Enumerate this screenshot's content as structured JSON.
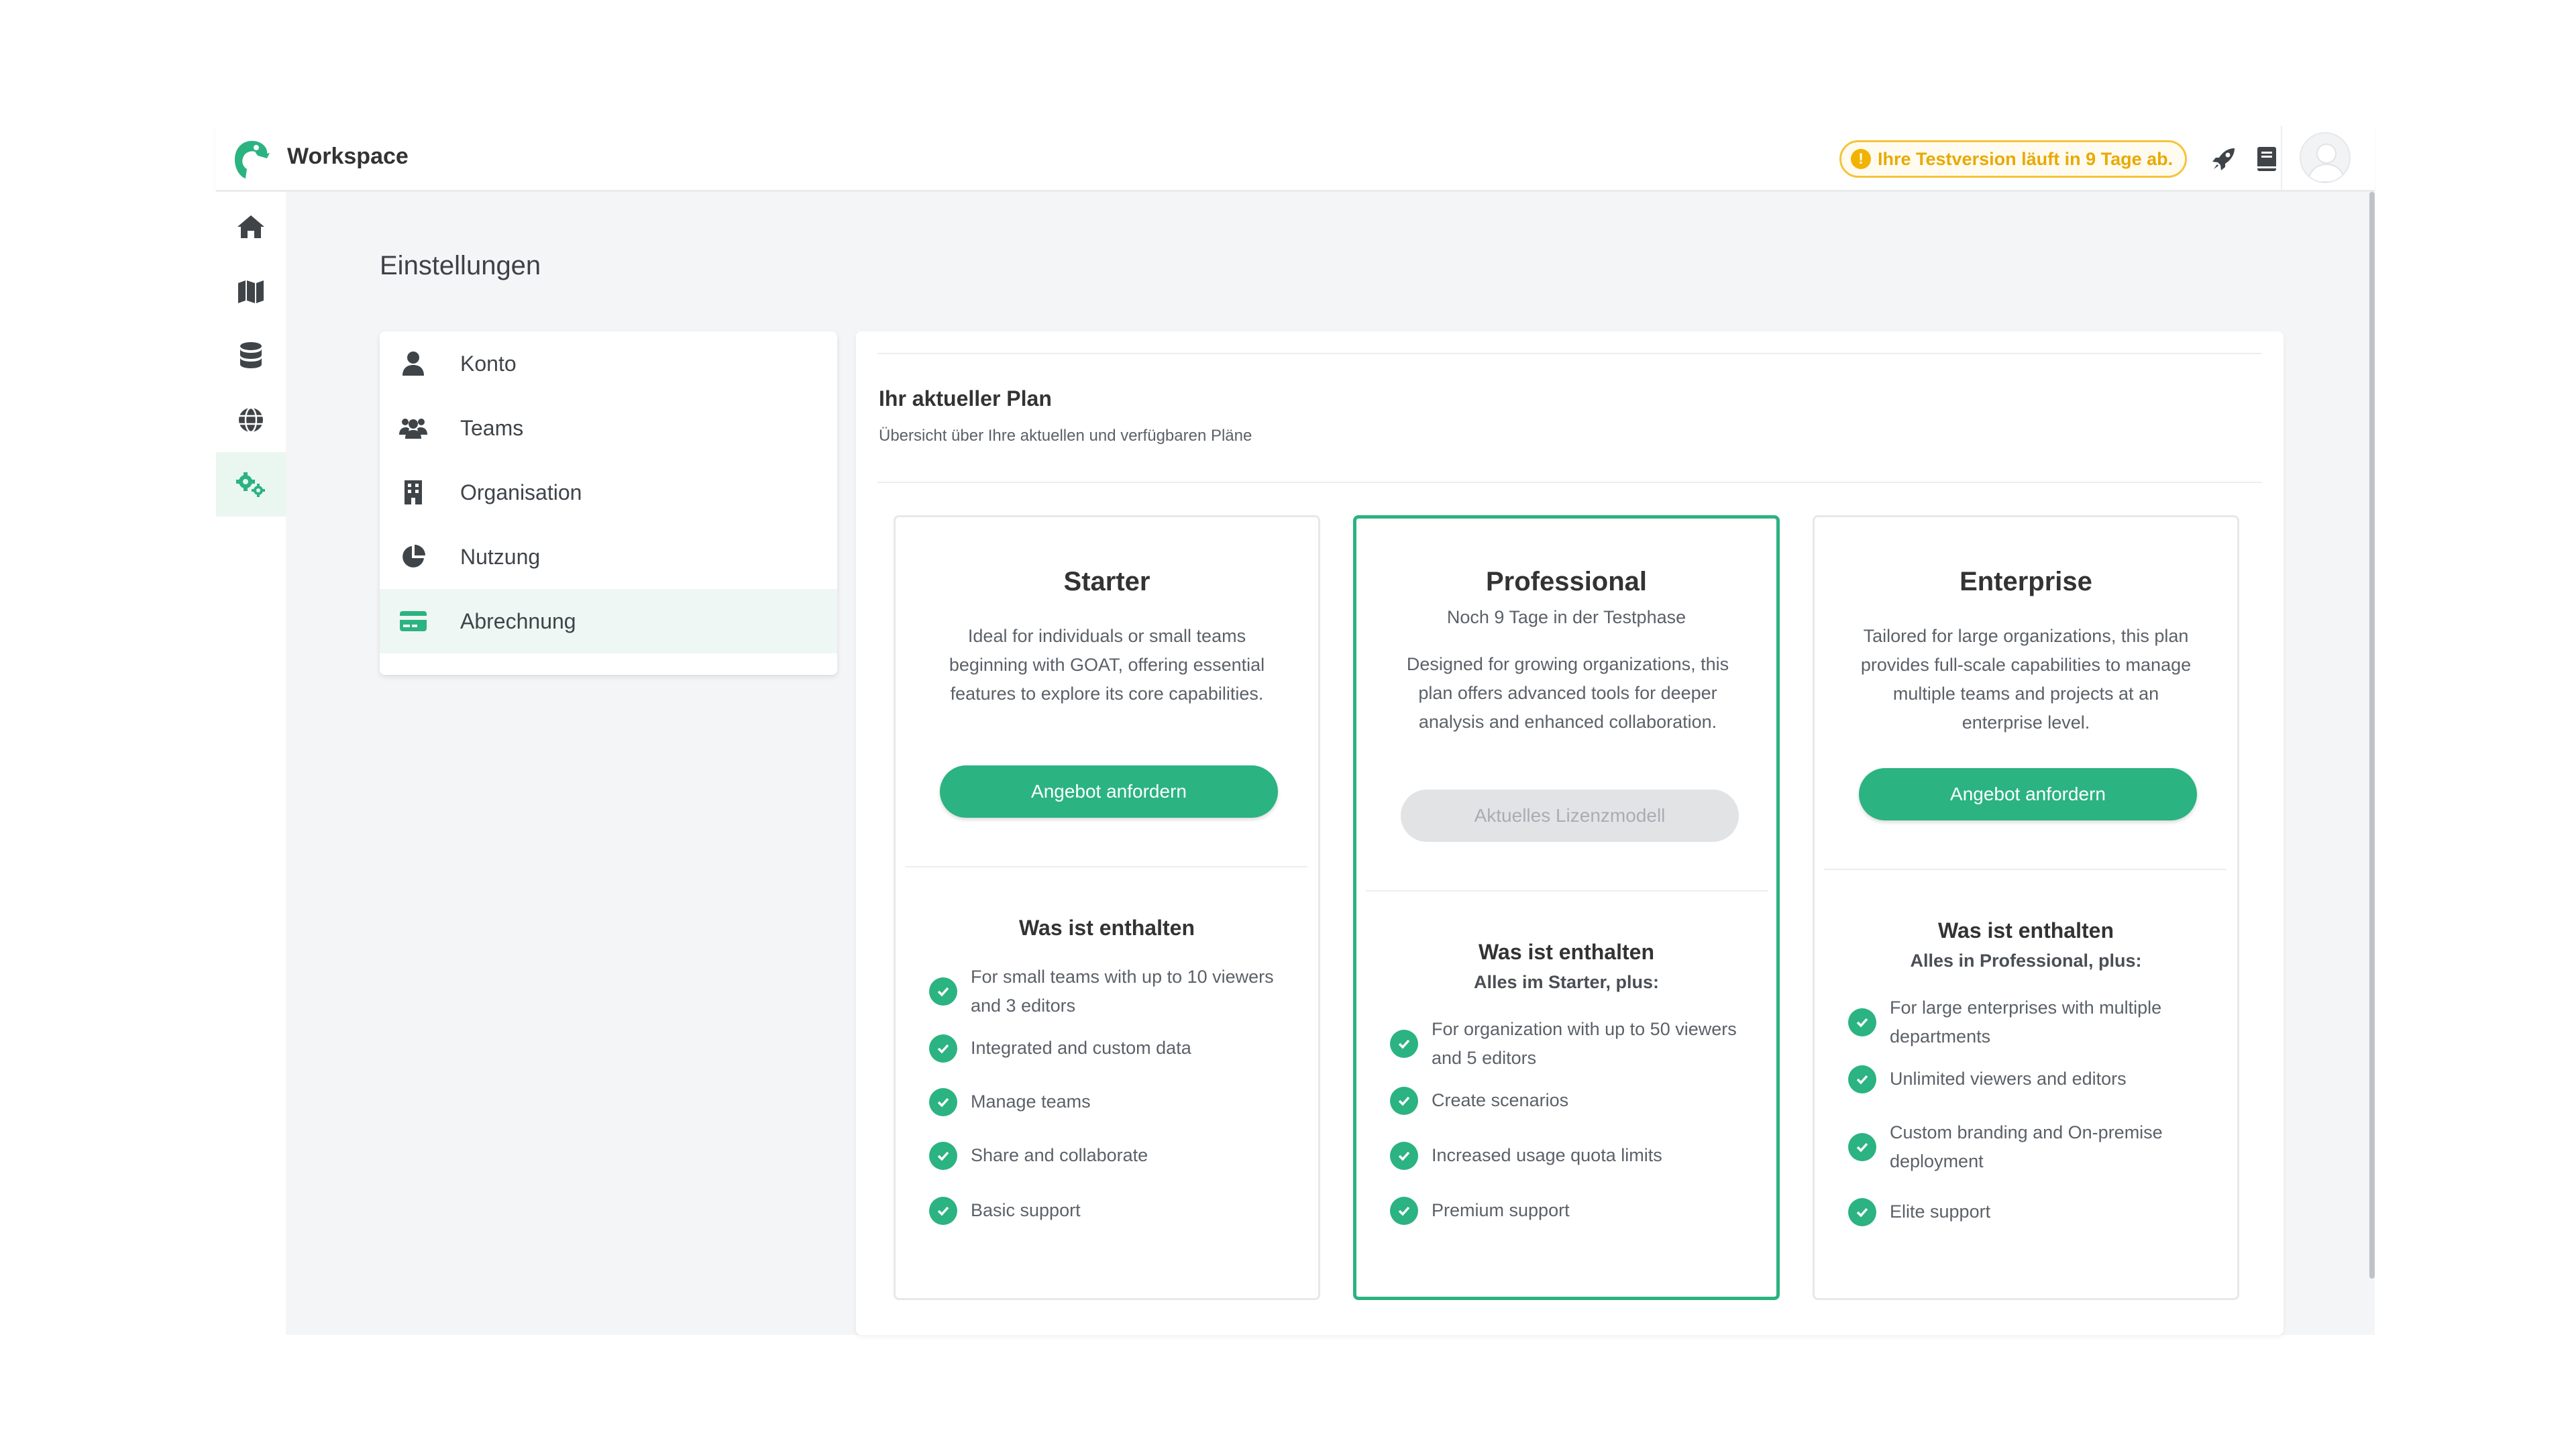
{
  "header": {
    "brand": "Workspace",
    "trial_notice": "Ihre Testversion läuft in 9 Tage ab.",
    "icons": [
      "rocket-icon",
      "book-icon"
    ]
  },
  "sidebar": {
    "items": [
      {
        "icon": "home-icon"
      },
      {
        "icon": "map-icon"
      },
      {
        "icon": "database-icon"
      },
      {
        "icon": "globe-icon"
      },
      {
        "icon": "settings-gears-icon",
        "active": true
      }
    ]
  },
  "page": {
    "title": "Einstellungen"
  },
  "settings_menu": {
    "items": [
      {
        "label": "Konto",
        "icon": "user-icon"
      },
      {
        "label": "Teams",
        "icon": "users-icon"
      },
      {
        "label": "Organisation",
        "icon": "building-icon"
      },
      {
        "label": "Nutzung",
        "icon": "pie-chart-icon"
      },
      {
        "label": "Abrechnung",
        "icon": "credit-card-icon",
        "active": true
      }
    ]
  },
  "plan_section": {
    "title": "Ihr aktueller Plan",
    "subtitle": "Übersicht über Ihre aktuellen und verfügbaren Pläne"
  },
  "plans": [
    {
      "name": "Starter",
      "description": "Ideal for individuals or small teams beginning with GOAT, offering essential features to explore its core capabilities.",
      "button": "Angebot anfordern",
      "included_title": "Was ist enthalten",
      "features": [
        "For small teams with up to 10 viewers and 3 editors",
        "Integrated and custom data",
        "Manage teams",
        "Share and collaborate",
        "Basic support"
      ]
    },
    {
      "name": "Professional",
      "trial": "Noch 9 Tage in der Testphase",
      "description": "Designed for growing organizations, this plan offers advanced tools for deeper analysis and enhanced collaboration.",
      "button": "Aktuelles Lizenzmodell",
      "included_title": "Was ist enthalten",
      "included_subtitle": "Alles im Starter, plus:",
      "features": [
        "For organization with up to 50 viewers and 5 editors",
        "Create scenarios",
        "Increased usage quota limits",
        "Premium support"
      ]
    },
    {
      "name": "Enterprise",
      "description": "Tailored for large organizations, this plan provides full-scale capabilities to manage multiple teams and projects at an enterprise level.",
      "button": "Angebot anfordern",
      "included_title": "Was ist enthalten",
      "included_subtitle": "Alles in Professional, plus:",
      "features": [
        "For large enterprises with multiple departments",
        "Unlimited viewers and editors",
        "Custom branding and On-premise deployment",
        "Elite support"
      ]
    }
  ],
  "colors": {
    "accent": "#2bb381",
    "trial_border": "#f4c43a",
    "trial_text": "#e9a900",
    "active_bg": "#eef7f3"
  }
}
